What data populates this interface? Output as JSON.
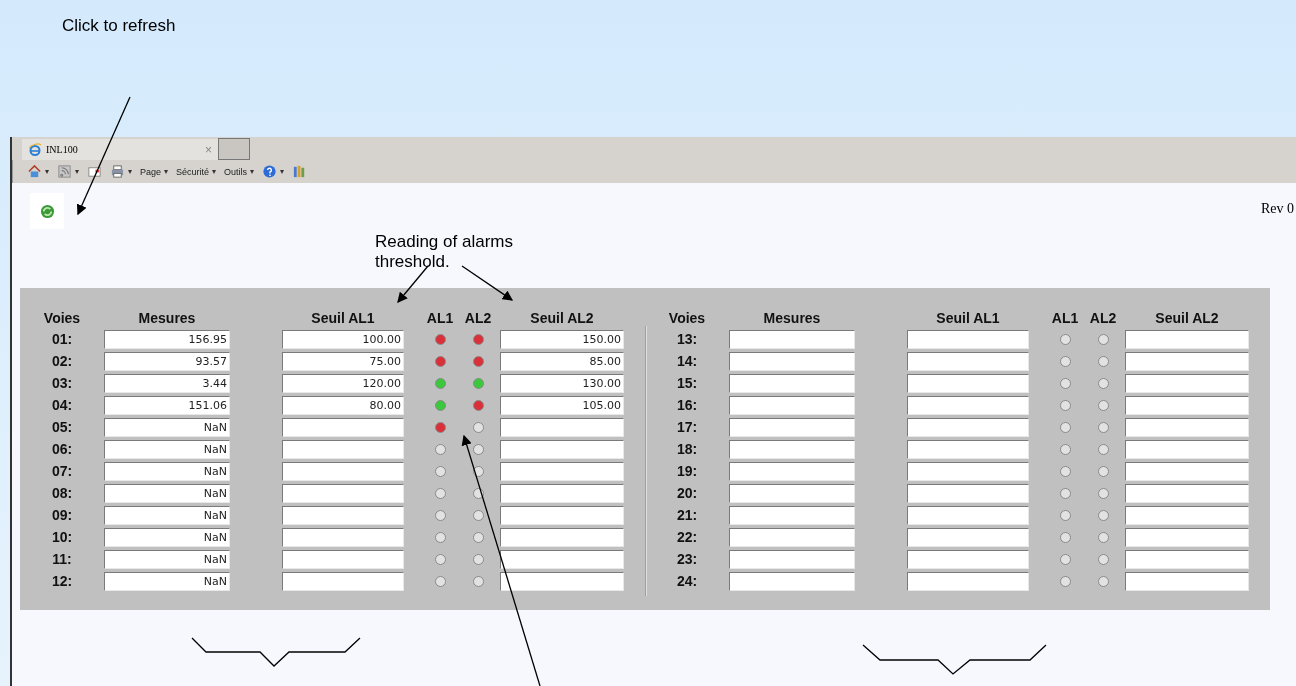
{
  "annotations": {
    "refresh": "Click to refresh",
    "thresholds": "Reading of alarms threshold."
  },
  "tab": {
    "title": "INL100",
    "close": "×"
  },
  "toolbar": [
    {
      "kind": "home",
      "caret": "▾"
    },
    {
      "kind": "feed",
      "caret": "▾"
    },
    {
      "kind": "mail"
    },
    {
      "kind": "print",
      "caret": "▾"
    },
    {
      "kind": "text",
      "label": "Page",
      "caret": "▾"
    },
    {
      "kind": "text",
      "label": "Sécurité",
      "caret": "▾"
    },
    {
      "kind": "text",
      "label": "Outils",
      "caret": "▾"
    },
    {
      "kind": "help",
      "caret": "▾"
    },
    {
      "kind": "research"
    }
  ],
  "revision": "Rev 0",
  "panels": [
    {
      "headers": [
        "Voies",
        "Mesures",
        "Seuil AL1",
        "AL1",
        "AL2",
        "Seuil AL2"
      ],
      "rows": [
        {
          "channel": "01:",
          "measure": "156.95",
          "threshold_al1": "100.00",
          "al1": {
            "color": "#d9303a"
          },
          "al2": {
            "color": "#d9303a"
          },
          "threshold_al2": "150.00"
        },
        {
          "channel": "02:",
          "measure": "93.57",
          "threshold_al1": "75.00",
          "al1": {
            "color": "#d9303a"
          },
          "al2": {
            "color": "#d9303a"
          },
          "threshold_al2": "85.00"
        },
        {
          "channel": "03:",
          "measure": "3.44",
          "threshold_al1": "120.00",
          "al1": {
            "color": "#3cc83c"
          },
          "al2": {
            "color": "#3cc83c"
          },
          "threshold_al2": "130.00"
        },
        {
          "channel": "04:",
          "measure": "151.06",
          "threshold_al1": "80.00",
          "al1": {
            "color": "#3cc83c"
          },
          "al2": {
            "color": "#d9303a"
          },
          "threshold_al2": "105.00"
        },
        {
          "channel": "05:",
          "measure": "NaN",
          "al1": {
            "color": "#d9303a"
          },
          "al2": {
            "color": "#e2e2e2"
          }
        },
        {
          "channel": "06:",
          "measure": "NaN",
          "al1": {
            "color": "#e2e2e2"
          },
          "al2": {
            "color": "#e2e2e2"
          }
        },
        {
          "channel": "07:",
          "measure": "NaN",
          "al1": {
            "color": "#e2e2e2"
          },
          "al2": {
            "color": "#e2e2e2"
          }
        },
        {
          "channel": "08:",
          "measure": "NaN",
          "al1": {
            "color": "#e2e2e2"
          },
          "al2": {
            "color": "#e2e2e2"
          }
        },
        {
          "channel": "09:",
          "measure": "NaN",
          "al1": {
            "color": "#e2e2e2"
          },
          "al2": {
            "color": "#e2e2e2"
          }
        },
        {
          "channel": "10:",
          "measure": "NaN",
          "al1": {
            "color": "#e2e2e2"
          },
          "al2": {
            "color": "#e2e2e2"
          }
        },
        {
          "channel": "11:",
          "measure": "NaN",
          "al1": {
            "color": "#e2e2e2"
          },
          "al2": {
            "color": "#e2e2e2"
          }
        },
        {
          "channel": "12:",
          "measure": "NaN",
          "al1": {
            "color": "#e2e2e2"
          },
          "al2": {
            "color": "#e2e2e2"
          }
        }
      ]
    },
    {
      "headers": [
        "Voies",
        "Mesures",
        "Seuil AL1",
        "AL1",
        "AL2",
        "Seuil AL2"
      ],
      "rows": [
        {
          "channel": "13:",
          "al1": {
            "color": "#e2e2e2"
          },
          "al2": {
            "color": "#e2e2e2"
          }
        },
        {
          "channel": "14:",
          "al1": {
            "color": "#e2e2e2"
          },
          "al2": {
            "color": "#e2e2e2"
          }
        },
        {
          "channel": "15:",
          "al1": {
            "color": "#e2e2e2"
          },
          "al2": {
            "color": "#e2e2e2"
          }
        },
        {
          "channel": "16:",
          "al1": {
            "color": "#e2e2e2"
          },
          "al2": {
            "color": "#e2e2e2"
          }
        },
        {
          "channel": "17:",
          "al1": {
            "color": "#e2e2e2"
          },
          "al2": {
            "color": "#e2e2e2"
          }
        },
        {
          "channel": "18:",
          "al1": {
            "color": "#e2e2e2"
          },
          "al2": {
            "color": "#e2e2e2"
          }
        },
        {
          "channel": "19:",
          "al1": {
            "color": "#e2e2e2"
          },
          "al2": {
            "color": "#e2e2e2"
          }
        },
        {
          "channel": "20:",
          "al1": {
            "color": "#e2e2e2"
          },
          "al2": {
            "color": "#e2e2e2"
          }
        },
        {
          "channel": "21:",
          "al1": {
            "color": "#e2e2e2"
          },
          "al2": {
            "color": "#e2e2e2"
          }
        },
        {
          "channel": "22:",
          "al1": {
            "color": "#e2e2e2"
          },
          "al2": {
            "color": "#e2e2e2"
          }
        },
        {
          "channel": "23:",
          "al1": {
            "color": "#e2e2e2"
          },
          "al2": {
            "color": "#e2e2e2"
          }
        },
        {
          "channel": "24:",
          "al1": {
            "color": "#e2e2e2"
          },
          "al2": {
            "color": "#e2e2e2"
          }
        }
      ]
    }
  ]
}
